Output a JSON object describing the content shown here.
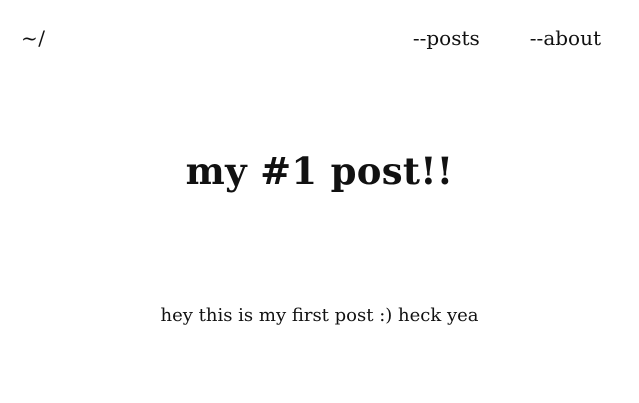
{
  "nav": {
    "home_label": "~/",
    "links": [
      {
        "label": "--posts"
      },
      {
        "label": "--about"
      }
    ]
  },
  "post": {
    "title": "my #1 post!!",
    "body": "hey this is my first post :) heck yea"
  }
}
